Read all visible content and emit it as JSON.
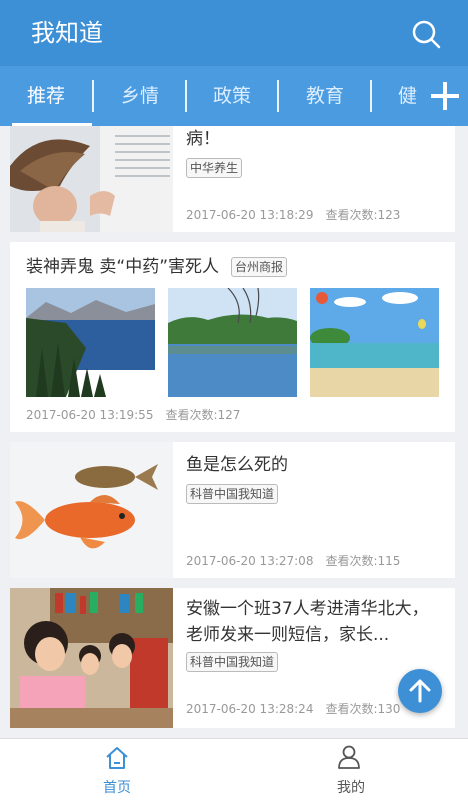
{
  "app": {
    "title": "我知道"
  },
  "tabs": [
    {
      "label": "推荐",
      "active": true
    },
    {
      "label": "乡情",
      "active": false
    },
    {
      "label": "政策",
      "active": false
    },
    {
      "label": "教育",
      "active": false
    },
    {
      "label": "健",
      "active": false
    }
  ],
  "icons": {
    "search": "search-icon",
    "add": "plus-icon",
    "scroll_top": "arrow-up-icon",
    "home": "home-icon",
    "profile": "person-icon"
  },
  "colors": {
    "primary": "#3d8fd6",
    "tab_bar": "#4a9be0"
  },
  "articles": [
    {
      "title": "病！",
      "tag": "中华养生",
      "time": "2017-06-20 13:18:29",
      "views": "查看次数:123"
    },
    {
      "title": "装神弄鬼 卖“中药”害死人",
      "tag": "台州商报",
      "time": "2017-06-20 13:19:55",
      "views": "查看次数:127"
    },
    {
      "title": "鱼是怎么死的",
      "tag": "科普中国我知道",
      "time": "2017-06-20 13:27:08",
      "views": "查看次数:115"
    },
    {
      "title": "安徽一个班37人考进清华北大，老师发来一则短信，家长...",
      "tag": "科普中国我知道",
      "time": "2017-06-20 13:28:24",
      "views": "查看次数:130"
    }
  ],
  "bottom_nav": [
    {
      "label": "首页",
      "active": true
    },
    {
      "label": "我的",
      "active": false
    }
  ]
}
